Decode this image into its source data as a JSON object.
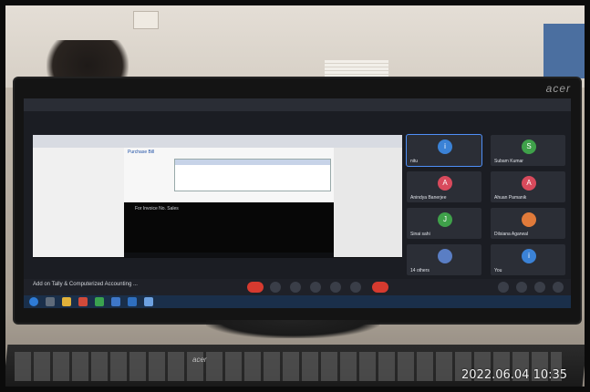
{
  "monitor": {
    "brand": "acer"
  },
  "meeting": {
    "title": "Add on Tally & Computerized Accounting ..."
  },
  "shared_screen": {
    "sheet_title": "Purchase Bill",
    "caption": "For Invoice No. Sales"
  },
  "participants": [
    {
      "initial": "i",
      "name": "nitu",
      "color": "#3b82d6",
      "active": true
    },
    {
      "initial": "S",
      "name": "Subam Kumar",
      "color": "#3fa14a",
      "active": false
    },
    {
      "initial": "A",
      "name": "Anindya Banerjee",
      "color": "#d84a5c",
      "active": false
    },
    {
      "initial": "A",
      "name": "Ahuan Pamanik",
      "color": "#d84a5c",
      "active": false
    },
    {
      "initial": "J",
      "name": "Sinai sahi",
      "color": "#3fa14a",
      "active": false
    },
    {
      "initial": "",
      "name": "Dilsiana Agarwal",
      "color": "#e07a3a",
      "active": false
    },
    {
      "initial": "",
      "name": "14 others",
      "color": "#5a7ec4",
      "active": false
    },
    {
      "initial": "i",
      "name": "You",
      "color": "#3b82d6",
      "active": false
    }
  ],
  "keyboard": {
    "brand": "acer"
  },
  "photo": {
    "timestamp": "2022.06.04 10:35"
  }
}
